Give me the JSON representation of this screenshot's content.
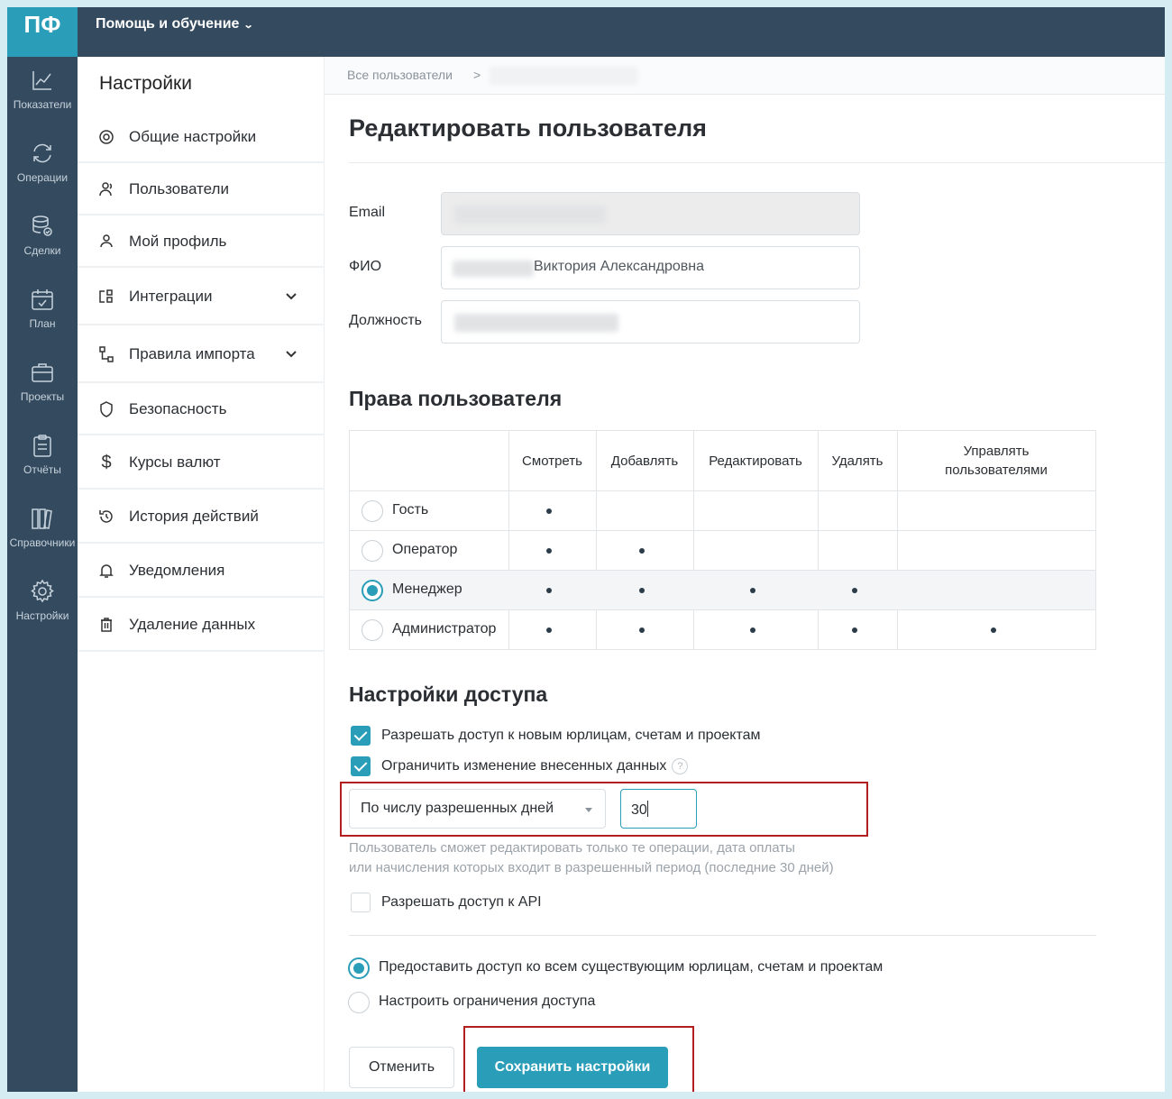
{
  "brand": {
    "logo": "ПФ",
    "help_menu": "Помощь и обучение"
  },
  "rail": [
    {
      "label": "Показатели",
      "icon": "chart-line-icon"
    },
    {
      "label": "Операции",
      "icon": "refresh-icon"
    },
    {
      "label": "Сделки",
      "icon": "database-check-icon"
    },
    {
      "label": "План",
      "icon": "calendar-check-icon"
    },
    {
      "label": "Проекты",
      "icon": "briefcase-icon"
    },
    {
      "label": "Отчёты",
      "icon": "clipboard-icon"
    },
    {
      "label": "Справочники",
      "icon": "books-icon"
    },
    {
      "label": "Настройки",
      "icon": "gear-icon"
    }
  ],
  "settings_nav": {
    "title": "Настройки",
    "items": [
      {
        "label": "Общие настройки",
        "icon": "settings-icon"
      },
      {
        "label": "Пользователи",
        "icon": "users-icon"
      },
      {
        "label": "Мой профиль",
        "icon": "user-icon"
      },
      {
        "label": "Интеграции",
        "icon": "integrations-icon"
      },
      {
        "label": "Правила импорта",
        "icon": "import-rules-icon"
      },
      {
        "label": "Безопасность",
        "icon": "shield-icon"
      },
      {
        "label": "Курсы валют",
        "icon": "dollar-icon"
      },
      {
        "label": "История действий",
        "icon": "history-icon"
      },
      {
        "label": "Уведомления",
        "icon": "bell-icon"
      },
      {
        "label": "Удаление данных",
        "icon": "trash-icon"
      }
    ]
  },
  "breadcrumb": {
    "root": "Все пользователи",
    "separator": ">"
  },
  "page_title": "Редактировать пользователя",
  "form": {
    "email_label": "Email",
    "fio_label": "ФИО",
    "fio_value_visible": "Виктория Александровна",
    "position_label": "Должность"
  },
  "rights": {
    "title": "Права пользователя",
    "columns": [
      "Смотреть",
      "Добавлять",
      "Редактировать",
      "Удалять",
      "Управлять пользователями"
    ],
    "rows": [
      {
        "role": "Гость",
        "selected": false,
        "perms": [
          true,
          false,
          false,
          false,
          false
        ]
      },
      {
        "role": "Оператор",
        "selected": false,
        "perms": [
          true,
          true,
          false,
          false,
          false
        ]
      },
      {
        "role": "Менеджер",
        "selected": true,
        "perms": [
          true,
          true,
          true,
          true,
          false
        ]
      },
      {
        "role": "Администратор",
        "selected": false,
        "perms": [
          true,
          true,
          true,
          true,
          true
        ]
      }
    ]
  },
  "access": {
    "title": "Настройки доступа",
    "allow_new": "Разрешать доступ к новым юрлицам, счетам и проектам",
    "allow_new_checked": true,
    "restrict_edit": "Ограничить изменение внесенных данных",
    "restrict_edit_checked": true,
    "help_mark": "?",
    "mode_select": "По числу разрешенных дней",
    "days_value": "30",
    "hint_line1": "Пользователь сможет редактировать только те операции, дата оплаты",
    "hint_line2": "или начисления которых входит в разрешенный период (последние 30 дней)",
    "api_access": "Разрешать доступ к API",
    "api_access_checked": false,
    "option_all": "Предоставить доступ ко всем существующим юрлицам, счетам и проектам",
    "option_restrict": "Настроить ограничения доступа"
  },
  "buttons": {
    "cancel": "Отменить",
    "save": "Сохранить настройки"
  },
  "colors": {
    "accent": "#2a9db8",
    "rail_bg": "#344a5e",
    "highlight_border": "#b31e1e"
  }
}
